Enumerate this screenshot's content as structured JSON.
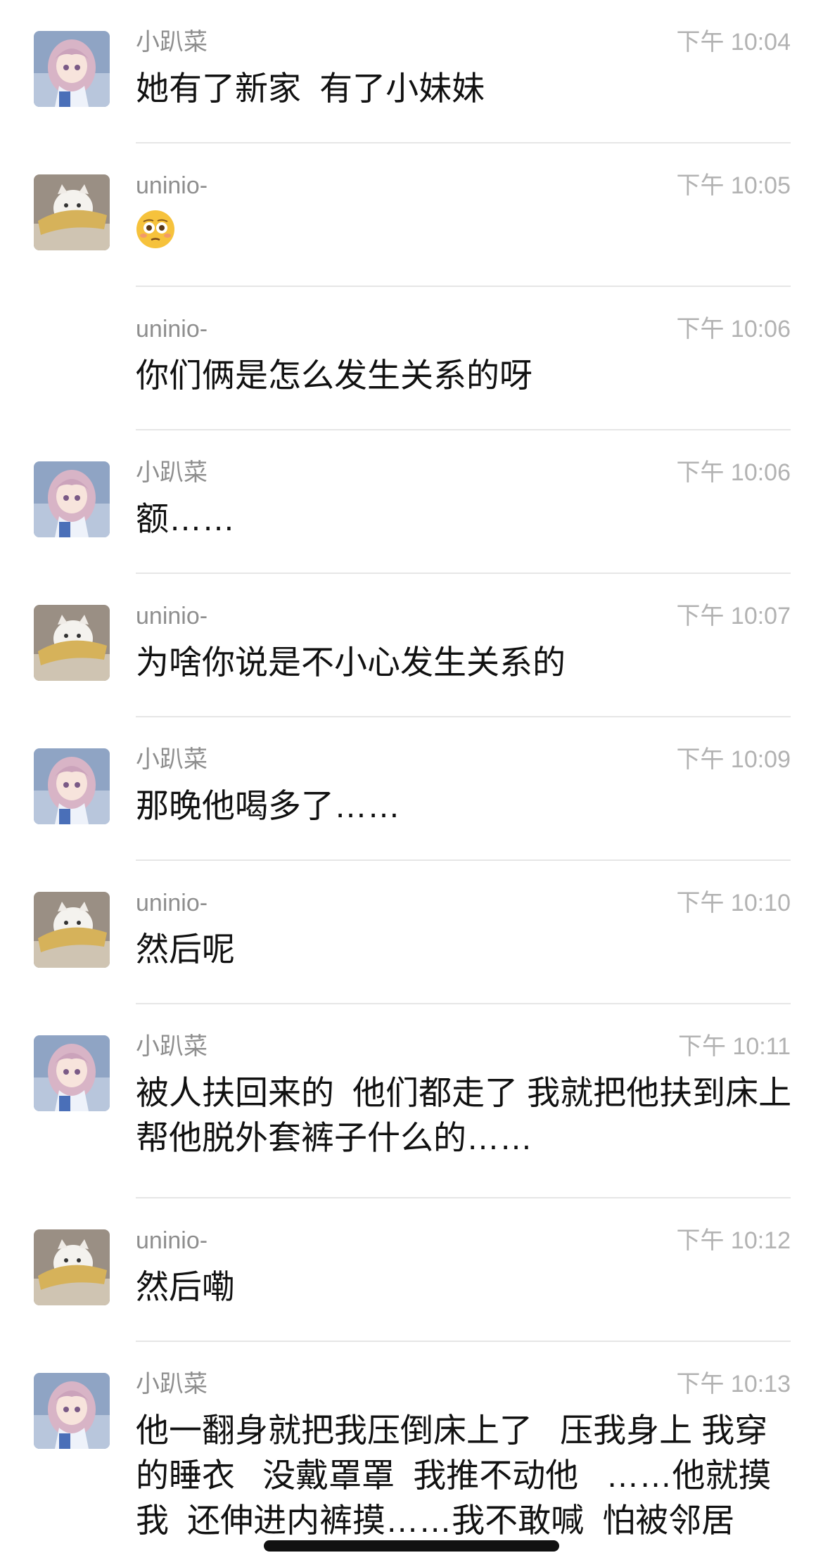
{
  "messages": [
    {
      "sender": "小趴菜",
      "time": "下午 10:04",
      "text": "她有了新家  有了小妹妹",
      "avatar": "anime-girl"
    },
    {
      "sender": "uninio-",
      "time": "下午 10:05",
      "text": "",
      "emoji": "flushed-face-emoji",
      "avatar": "white-kitten"
    },
    {
      "sender": "uninio-",
      "time": "下午 10:06",
      "text": "你们俩是怎么发生关系的呀",
      "avatar": ""
    },
    {
      "sender": "小趴菜",
      "time": "下午 10:06",
      "text": "额……",
      "avatar": "anime-girl"
    },
    {
      "sender": "uninio-",
      "time": "下午 10:07",
      "text": "为啥你说是不小心发生关系的",
      "avatar": "white-kitten"
    },
    {
      "sender": "小趴菜",
      "time": "下午 10:09",
      "text": "那晚他喝多了……",
      "avatar": "anime-girl"
    },
    {
      "sender": "uninio-",
      "time": "下午 10:10",
      "text": "然后呢",
      "avatar": "white-kitten"
    },
    {
      "sender": "小趴菜",
      "time": "下午 10:11",
      "text": "被人扶回来的  他们都走了 我就把他扶到床上  帮他脱外套裤子什么的……",
      "avatar": "anime-girl"
    },
    {
      "sender": "uninio-",
      "time": "下午 10:12",
      "text": "然后嘞",
      "avatar": "white-kitten"
    },
    {
      "sender": "小趴菜",
      "time": "下午 10:13",
      "text": "他一翻身就把我压倒床上了   压我身上 我穿的睡衣   没戴罩罩  我推不动他   ……他就摸我  还伸进内裤摸……我不敢喊  怕被邻居",
      "avatar": "anime-girl"
    }
  ]
}
